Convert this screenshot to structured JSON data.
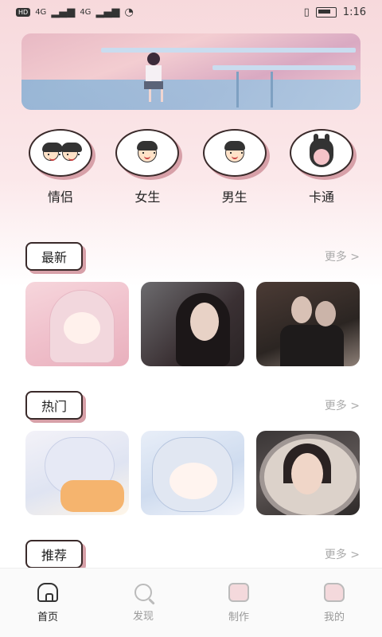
{
  "status": {
    "time": "1:16",
    "network_left": "HD",
    "signal1": "4G",
    "signal2": "4G"
  },
  "categories": [
    {
      "label": "情侣",
      "icon": "couple-icon"
    },
    {
      "label": "女生",
      "icon": "girl-icon"
    },
    {
      "label": "男生",
      "icon": "boy-icon"
    },
    {
      "label": "卡通",
      "icon": "totoro-icon"
    }
  ],
  "sections": {
    "latest": {
      "title": "最新",
      "more": "更多 >"
    },
    "hot": {
      "title": "热门",
      "more": "更多 >"
    },
    "recommend": {
      "title": "推荐",
      "more": "更多 >"
    }
  },
  "tabbar": [
    {
      "label": "首页",
      "icon": "home-icon",
      "active": true
    },
    {
      "label": "发现",
      "icon": "discover-icon",
      "active": false
    },
    {
      "label": "制作",
      "icon": "make-icon",
      "active": false
    },
    {
      "label": "我的",
      "icon": "mine-icon",
      "active": false
    }
  ],
  "colors": {
    "accent_pink": "#d7a0a8",
    "outline": "#3a2a2a",
    "muted": "#aaaaaa"
  }
}
